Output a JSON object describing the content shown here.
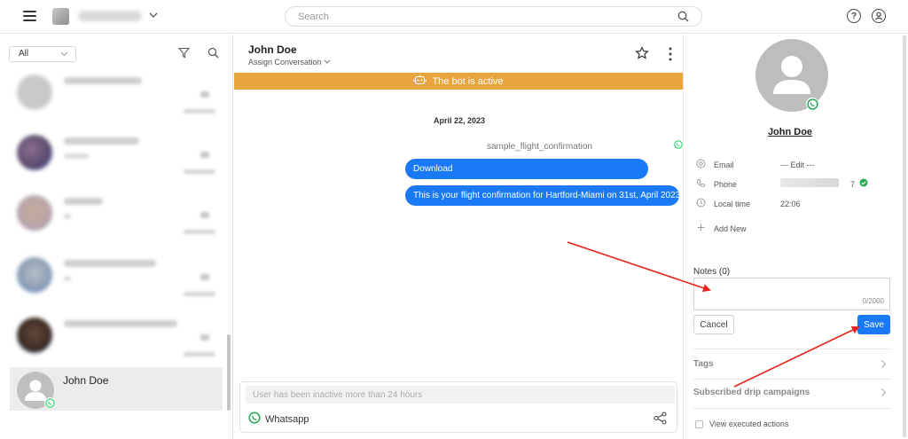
{
  "header": {
    "search_placeholder": "Search",
    "icons": [
      "hamburger-icon",
      "search-icon",
      "help-icon",
      "user-icon"
    ],
    "help_glyph": "?"
  },
  "sidebar": {
    "filter_value": "All",
    "active_conversation": {
      "name": "John Doe",
      "channel_icon": "whatsapp-icon"
    }
  },
  "chat": {
    "contact_name": "John Doe",
    "assign_label": "Assign Conversation",
    "bot_banner": "The bot is active",
    "date": "April 22, 2023",
    "template_name": "sample_flight_confirmation",
    "messages": [
      "Download",
      "This is your flight confirmation for Hartford-Miami on 31st, April 2023."
    ],
    "composer_placeholder": "User has been inactive more than 24 hours",
    "channel": "Whatsapp"
  },
  "contact_panel": {
    "name": "John Doe",
    "attributes": [
      {
        "label": "Email",
        "value": "--- Edit ---",
        "icon": "at-icon"
      },
      {
        "label": "Phone",
        "value": "7",
        "icon": "phone-icon"
      },
      {
        "label": "Local time",
        "value": "22:06",
        "icon": "clock-icon"
      }
    ],
    "add_new": "Add New",
    "notes_label": "Notes (0)",
    "notes_counter": "0/2000",
    "cancel": "Cancel",
    "save": "Save",
    "tags": "Tags",
    "drip": "Subscribed drip campaigns",
    "view_executed": "View executed actions"
  },
  "colors": {
    "accent": "#1a7af5",
    "bot_banner": "#e8a53d",
    "whatsapp": "#25d366",
    "annotation": "#e8231c"
  }
}
